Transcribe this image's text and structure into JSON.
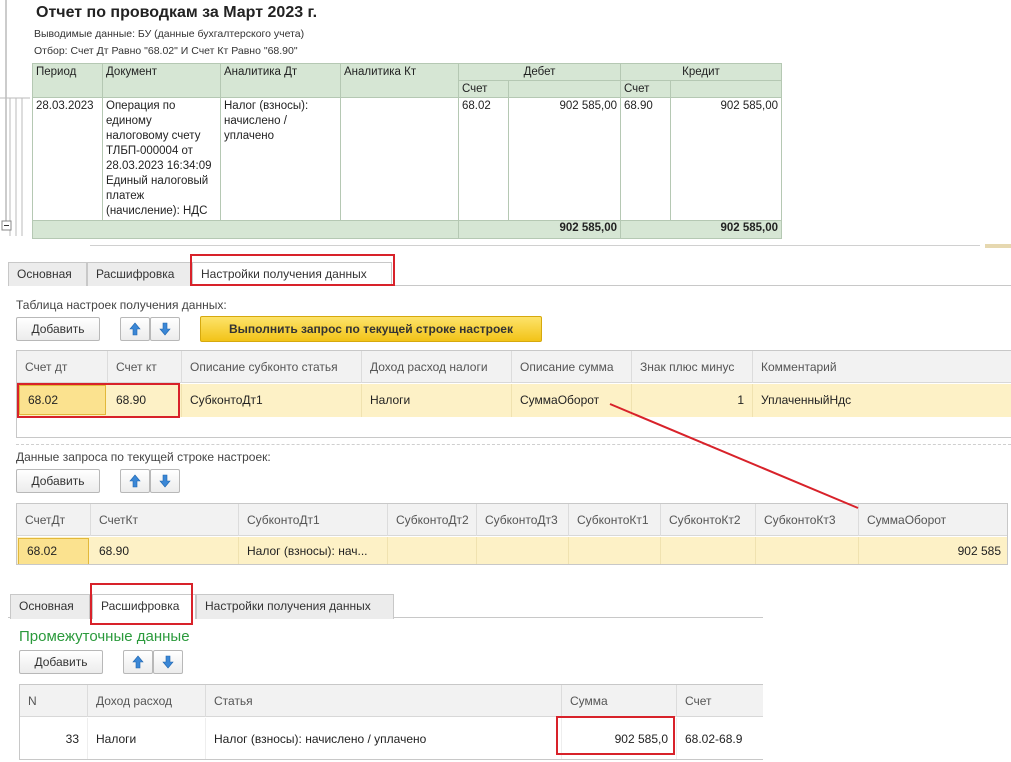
{
  "report": {
    "title": "Отчет по проводкам за Март 2023 г.",
    "output_data": "Выводимые данные: БУ (данные бухгалтерского учета)",
    "filter": "Отбор: Счет Дт Равно \"68.02\" И Счет Кт Равно \"68.90\"",
    "headers": {
      "period": "Период",
      "document": "Документ",
      "analytics_dt": "Аналитика Дт",
      "analytics_kt": "Аналитика Кт",
      "debit": "Дебет",
      "credit": "Кредит",
      "account": "Счет"
    },
    "row": {
      "period": "28.03.2023",
      "document": "Операция по единому налоговому счету ТЛБП-000004 от 28.03.2023 16:34:09 Единый налоговый платеж (начисление): НДС",
      "analytics_dt": "Налог (взносы): начислено / уплачено",
      "analytics_kt": "",
      "debit_account": "68.02",
      "debit_amount": "902 585,00",
      "credit_account": "68.90",
      "credit_amount": "902 585,00"
    },
    "total": {
      "debit_amount": "902 585,00",
      "credit_amount": "902 585,00"
    }
  },
  "tabs1": [
    "Основная",
    "Расшифровка",
    "Настройки получения данных"
  ],
  "settings": {
    "table_label": "Таблица настроек получения данных:",
    "add_label": "Добавить",
    "run_query_label": "Выполнить запрос по текущей строке настроек",
    "columns": [
      "Счет дт",
      "Счет кт",
      "Описание субконто статья",
      "Доход расход налоги",
      "Описание сумма",
      "Знак плюс минус",
      "Комментарий"
    ],
    "row": [
      "68.02",
      "68.90",
      "СубконтоДт1",
      "Налоги",
      "СуммаОборот",
      "1",
      "УплаченныйНдс"
    ]
  },
  "query": {
    "label": "Данные запроса по текущей строке настроек:",
    "add_label": "Добавить",
    "columns": [
      "СчетДт",
      "СчетКт",
      "СубконтоДт1",
      "СубконтоДт2",
      "СубконтоДт3",
      "СубконтоКт1",
      "СубконтоКт2",
      "СубконтоКт3",
      "СуммаОборот"
    ],
    "row": [
      "68.02",
      "68.90",
      "Налог (взносы): нач...",
      "",
      "",
      "",
      "",
      "",
      "902 585"
    ]
  },
  "tabs2": [
    "Основная",
    "Расшифровка",
    "Настройки получения данных"
  ],
  "intermediate": {
    "title": "Промежуточные данные",
    "add_label": "Добавить",
    "columns": [
      "N",
      "Доход расход",
      "Статья",
      "Сумма",
      "Счет"
    ],
    "row": [
      "33",
      "Налоги",
      "Налог (взносы): начислено / уплачено",
      "902 585,0",
      "68.02-68.9"
    ]
  },
  "colors": {
    "header_green": "#d6e6d4",
    "selected_row": "#fdf1c6",
    "highlight_red": "#d8222a",
    "yellow_button": "#f2c318",
    "title_green": "#2b9a3c"
  }
}
